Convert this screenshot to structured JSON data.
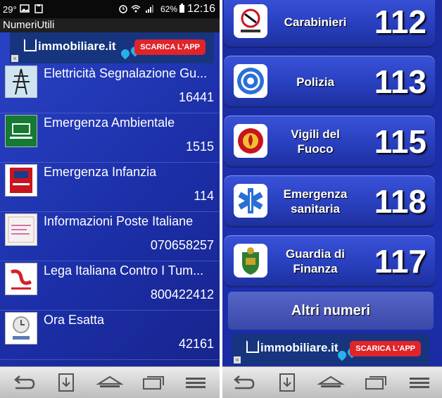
{
  "status_bar": {
    "temperature": "29°",
    "battery_percent": "62%",
    "time": "12:16"
  },
  "app_title": "NumeriUtili",
  "ad": {
    "brand": "immobiliare.it",
    "cta": "SCARICA L'APP",
    "close": "×"
  },
  "list_items": [
    {
      "name": "Elettricità Segnalazione Gu...",
      "number": "16441",
      "icon": "power-pylon-icon"
    },
    {
      "name": "Emergenza Ambientale",
      "number": "1515",
      "icon": "forestry-1515-icon"
    },
    {
      "name": "Emergenza Infanzia",
      "number": "114",
      "icon": "child-emergency-114-icon"
    },
    {
      "name": "Informazioni Poste Italiane",
      "number": "070658257",
      "icon": "poste-italiane-icon"
    },
    {
      "name": "Lega Italiana Contro I Tum...",
      "number": "800422412",
      "icon": "lilt-logo-icon"
    },
    {
      "name": "Ora Esatta",
      "number": "42161",
      "icon": "clock-42161-icon"
    }
  ],
  "emergency_buttons": [
    {
      "label": "Carabinieri",
      "number": "112",
      "icon": "carabinieri-icon"
    },
    {
      "label": "Polizia",
      "number": "113",
      "icon": "polizia-icon"
    },
    {
      "label": "Vigili del Fuoco",
      "number": "115",
      "icon": "vigili-del-fuoco-icon"
    },
    {
      "label": "Emergenza sanitaria",
      "number": "118",
      "icon": "star-of-life-icon"
    },
    {
      "label": "Guardia di Finanza",
      "number": "117",
      "icon": "guardia-di-finanza-icon"
    }
  ],
  "altri_numeri": "Altri numeri",
  "nav_icons": [
    "back-icon",
    "download-icon",
    "home-icon",
    "recent-apps-icon",
    "menu-icon"
  ]
}
